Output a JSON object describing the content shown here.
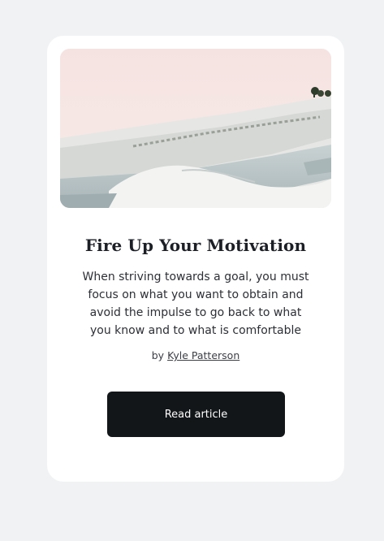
{
  "card": {
    "title": "Fire Up Your Motivation",
    "description": "When striving towards a goal, you must focus on what you want to obtain and avoid the impulse to go back to what you know and to what is comfortable",
    "byline_prefix": "by",
    "author": "Kyle Patterson",
    "button_label": "Read article"
  },
  "colors": {
    "page_bg": "#f1f2f4",
    "card_bg": "#ffffff",
    "title": "#1d1f27",
    "button_bg": "#121619",
    "button_text": "#ffffff"
  }
}
